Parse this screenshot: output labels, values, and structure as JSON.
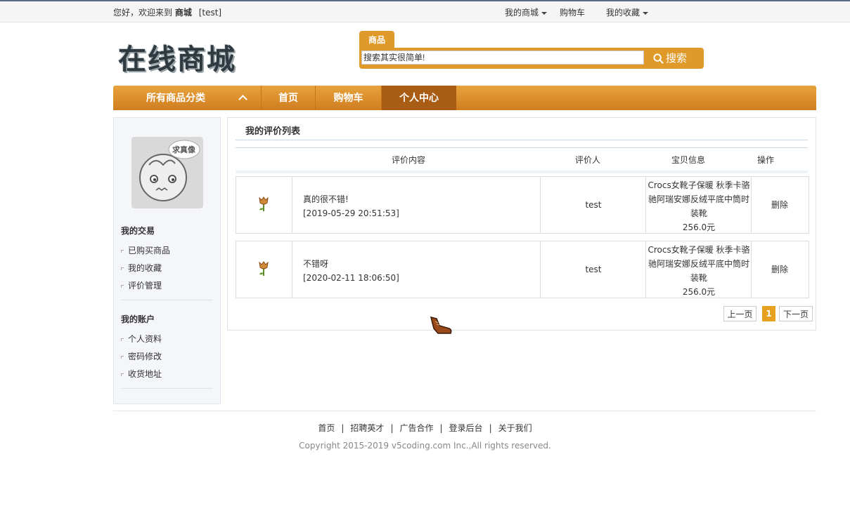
{
  "topbar": {
    "greeting_prefix": "您好，欢迎来到",
    "site": "商城",
    "user": "[test]",
    "links": [
      {
        "label": "我的商城",
        "dropdown": true
      },
      {
        "label": "购物车",
        "dropdown": false
      },
      {
        "label": "我的收藏",
        "dropdown": true
      }
    ]
  },
  "logo": {
    "text": "在线商城"
  },
  "search": {
    "tab": "商品",
    "value": "搜索其实很简单!",
    "button": "搜索"
  },
  "nav": {
    "category": "所有商品分类",
    "items": [
      "首页",
      "购物车",
      "个人中心"
    ],
    "active_index": 2
  },
  "sidebar": {
    "avatar_text": "求真像",
    "groups": [
      {
        "title": "我的交易",
        "items": [
          "已购买商品",
          "我的收藏",
          "评价管理"
        ]
      },
      {
        "title": "我的账户",
        "items": [
          "个人资料",
          "密码修改",
          "收货地址"
        ]
      }
    ]
  },
  "main": {
    "title": "我的评价列表",
    "columns": [
      "评价内容",
      "评价人",
      "宝贝信息",
      "操作"
    ],
    "rows": [
      {
        "comment": "真的很不错!",
        "time": "[2019-05-29 20:51:53]",
        "user": "test",
        "product_line1": "Crocs女靴子保暖 秋季卡骆",
        "product_line2": "驰阿瑞安娜反绒平底中筒时",
        "product_line3": "装靴",
        "price": "256.0元",
        "action": "删除"
      },
      {
        "comment": "不错呀",
        "time": "[2020-02-11 18:06:50]",
        "user": "test",
        "product_line1": "Crocs女靴子保暖 秋季卡骆",
        "product_line2": "驰阿瑞安娜反绒平底中筒时",
        "product_line3": "装靴",
        "price": "256.0元",
        "action": "删除"
      }
    ],
    "pager": {
      "prev": "上一页",
      "current": "1",
      "next": "下一页"
    }
  },
  "footer": {
    "links": [
      "首页",
      "招聘英才",
      "广告合作",
      "登录后台",
      "关于我们"
    ],
    "separator": "|",
    "copyright": "Copyright 2015-2019 v5coding.com Inc.,All rights reserved."
  },
  "colors": {
    "accent": "#e09a2a",
    "nav_active": "#a85c14",
    "current_page": "#e8a020"
  }
}
